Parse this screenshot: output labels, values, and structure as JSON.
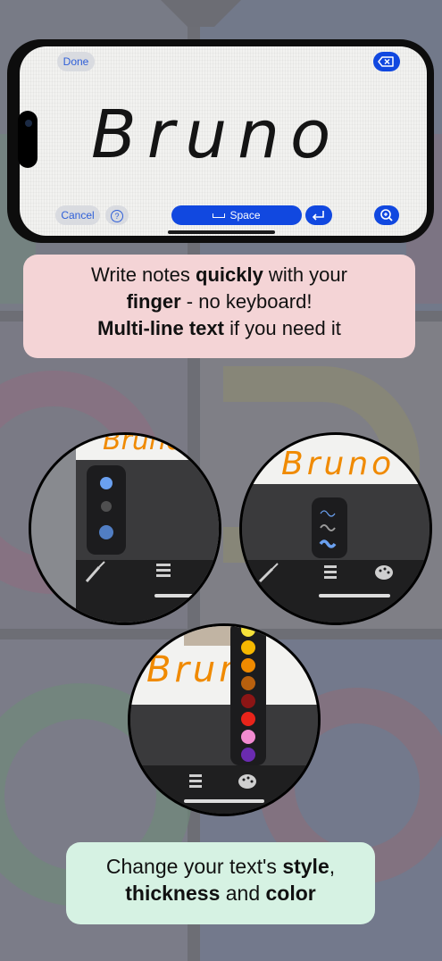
{
  "editor": {
    "done_label": "Done",
    "cancel_label": "Cancel",
    "help_glyph": "?",
    "space_label": "Space",
    "handwriting_text": "Bruno",
    "icons": [
      "delete-icon",
      "help-icon",
      "return-icon",
      "zoom-icon"
    ]
  },
  "caption_top": {
    "p1": "Write notes ",
    "b1": "quickly",
    "p2": " with your",
    "b2": "finger",
    "p3": " - no keyboard!",
    "b3": "Multi-line text",
    "p4": " if you need it"
  },
  "circles": {
    "handwriting_text": "Bruno",
    "style_options": [
      "solid",
      "blur",
      "splatter"
    ],
    "thickness_options": [
      "thin",
      "medium",
      "thick"
    ],
    "palette_colors": [
      "#f5e13a",
      "#f5b700",
      "#f08a00",
      "#b8600e",
      "#8c1515",
      "#e8241a",
      "#f28bd1",
      "#6a2bb0"
    ],
    "toolbar_icons": [
      "brush-icon",
      "lines-icon",
      "palette-icon"
    ]
  },
  "caption_bottom": {
    "p1": "Change your text's ",
    "b1": "style",
    "p2": ",",
    "b2": "thickness",
    "p3": " and ",
    "b3": "color"
  },
  "colors": {
    "accent_blue": "#1148e0",
    "caption_pink": "#f4d4d6",
    "caption_green": "#d6f2e3",
    "ink_orange": "#f08a00"
  }
}
